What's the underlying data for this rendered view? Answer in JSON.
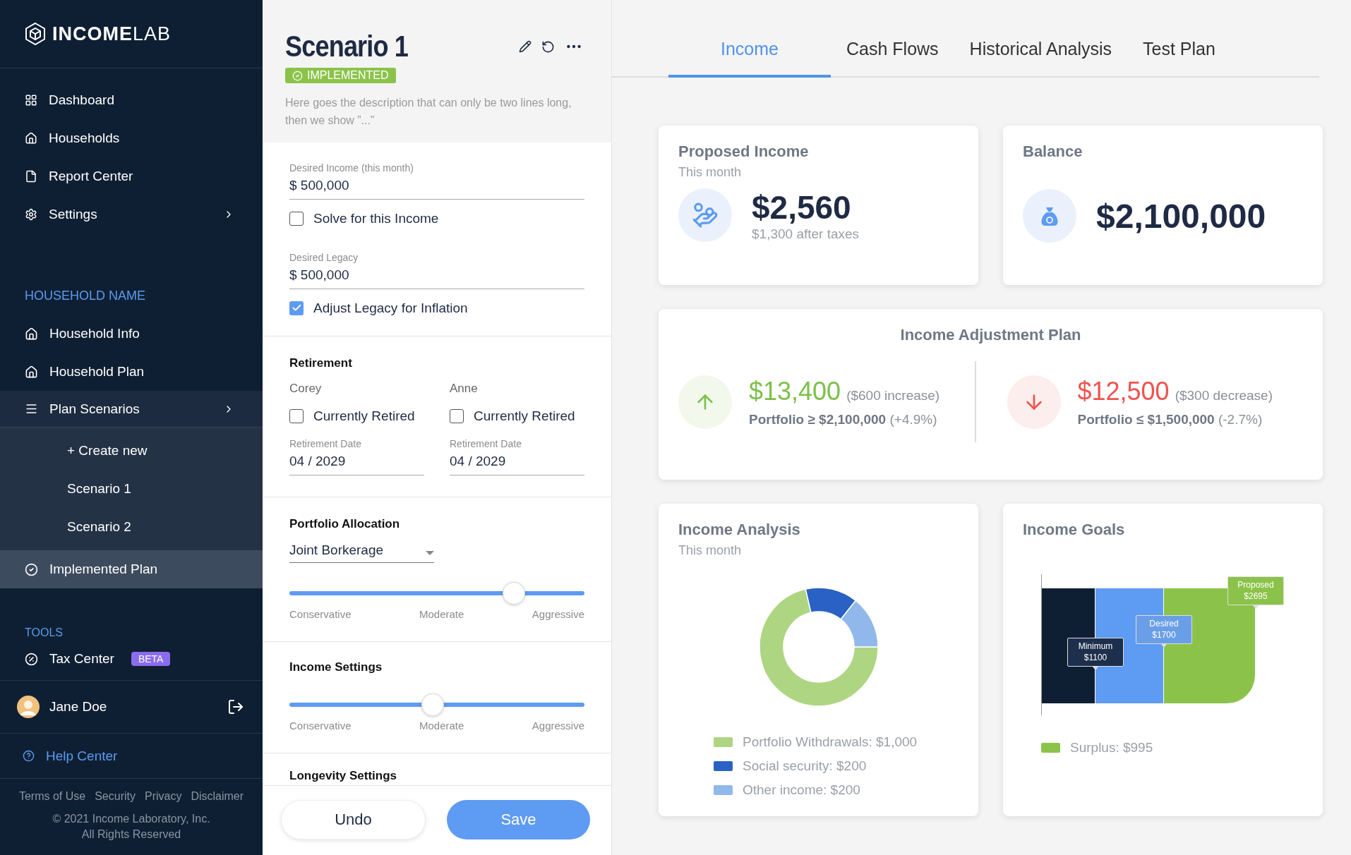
{
  "sidebar": {
    "brand": "**INCOME**LAB",
    "nav": [
      {
        "label": "Dashboard",
        "expandable": false
      },
      {
        "label": "Households",
        "expandable": false
      },
      {
        "label": "Report Center",
        "expandable": false
      },
      {
        "label": "Settings",
        "expandable": true
      }
    ],
    "household": {
      "heading": "HOUSEHOLD NAME",
      "items": [
        {
          "label": "Household Info",
          "expandable": false,
          "selected": false
        },
        {
          "label": "Household Plan",
          "expandable": false,
          "selected": false
        },
        {
          "label": "Plan Scenarios",
          "expandable": true,
          "selected": false,
          "children": [
            {
              "label": "+ Create new",
              "selected": false
            },
            {
              "label": "Scenario 1",
              "selected": false
            },
            {
              "label": "Scenario 2",
              "selected": false
            }
          ]
        },
        {
          "label": "Implemented Plan",
          "expandable": false,
          "selected": true
        }
      ]
    },
    "tools": {
      "heading": "TOOLS",
      "items": [
        {
          "label": "Tax Center",
          "badge": "BETA"
        }
      ]
    },
    "user": {
      "name": "Jane Doe"
    },
    "help": "Help Center",
    "footer_links": [
      "Terms of Use",
      "Security",
      "Privacy",
      "Disclaimer"
    ],
    "copyright": [
      "© 2021 Income Laboratory, Inc.",
      "All Rights Reserved"
    ]
  },
  "scenario": {
    "title": "Scenario 1",
    "status": "IMPLEMENTED",
    "description": "Here goes the description that can only be two lines long, then we show ”...”",
    "desired_income": {
      "label": "Desired Income (this month)",
      "value": "$ 500,000"
    },
    "solve": {
      "label": "Solve for this Income",
      "checked": false
    },
    "desired_legacy": {
      "label": "Desired Legacy",
      "value": "$ 500,000"
    },
    "inflation": {
      "label": "Adjust Legacy for Inflation",
      "checked": true
    },
    "retirement": {
      "heading": "Retirement",
      "people": [
        {
          "name": "Corey",
          "retired": {
            "label": "Currently Retired",
            "checked": false
          },
          "date_label": "Retirement Date",
          "date": "04 / 2029"
        },
        {
          "name": "Anne",
          "retired": {
            "label": "Currently Retired",
            "checked": false
          },
          "date_label": "Retirement Date",
          "date": "04 / 2029"
        }
      ]
    },
    "portfolio": {
      "heading": "Portfolio Allocation",
      "account": "Joint Borkerage",
      "slider": {
        "level": 0.76,
        "labels": [
          "Conservative",
          "Moderate",
          "Aggressive"
        ]
      }
    },
    "income_settings": {
      "heading": "Income Settings",
      "slider": {
        "level": 0.485,
        "labels": [
          "Conservative",
          "Moderate",
          "Aggressive"
        ]
      }
    },
    "longevity": {
      "heading": "Longevity Settings"
    },
    "buttons": [
      {
        "label": "Undo",
        "kind": "secondary"
      },
      {
        "label": "Save",
        "kind": "primary"
      }
    ]
  },
  "tabs": [
    {
      "label": "Income",
      "selected": true
    },
    {
      "label": "Cash Flows",
      "selected": false
    },
    {
      "label": "Historical Analysis",
      "selected": false
    },
    {
      "label": "Test Plan",
      "selected": false
    }
  ],
  "proposed_income": {
    "title": "Proposed Income",
    "subtitle": "This month",
    "amount": "$2,560",
    "note": "$1,300 after taxes"
  },
  "balance": {
    "title": "Balance",
    "amount": "$2,100,000"
  },
  "adjustment": {
    "title": "Income Adjustment Plan",
    "options": [
      {
        "kind": "increase",
        "amount": "$13,400",
        "change": "($600 increase)",
        "condition": "**Portfolio ≥ $2,100,000** (+4.9%)"
      },
      {
        "kind": "decrease",
        "amount": "$12,500",
        "change": "($300 decrease)",
        "condition": "**Portfolio ≤ $1,500,000** (-2.7%)"
      }
    ]
  },
  "income_analysis": {
    "title": "Income Analysis",
    "subtitle": "This month",
    "chart_data": {
      "type": "donut",
      "categories": [
        "Portfolio Withdrawals: $1,000",
        "Social security: $200",
        "Other income: $200"
      ],
      "values": [
        1000,
        200,
        200
      ]
    },
    "legend": [
      {
        "color": "#aed581"
      },
      {
        "color": "#2962c4"
      },
      {
        "color": "#90b8ea"
      }
    ]
  },
  "income_goals": {
    "title": "Income Goals",
    "markers": [
      {
        "label": "Minimum",
        "amount": "$1100",
        "color": "#0f1f33"
      },
      {
        "label": "Desired",
        "amount": "$1700",
        "color": "#5e9bf2"
      },
      {
        "label": "Proposed",
        "amount": "$2695",
        "color": "#8bc34a"
      }
    ],
    "legend": [
      {
        "label": "Surplus: $995",
        "color": "#8bc34a"
      }
    ]
  }
}
